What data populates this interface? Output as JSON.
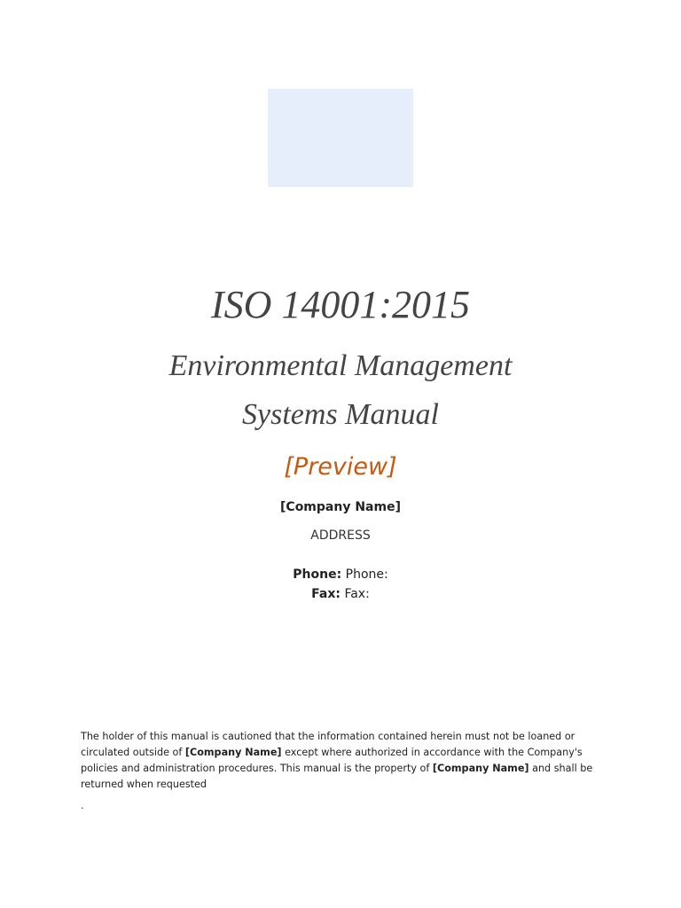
{
  "cover": {
    "standard": "ISO 14001:2015",
    "title_line1": "Environmental Management",
    "title_line2": "Systems Manual",
    "preview": "[Preview]",
    "company": "[Company Name]",
    "address": "ADDRESS",
    "phone_label": "Phone:",
    "phone_value": "Phone:",
    "fax_label": "Fax:",
    "fax_value": "Fax:"
  },
  "disclaimer": {
    "part1": "The holder of this manual is cautioned that the information contained herein must not be loaned or circulated outside of ",
    "company1": "[Company Name]",
    "part2": " except where authorized in accordance with the Company's policies and administration procedures. This manual is the property of ",
    "company2": "[Company Name]",
    "part3": " and shall be returned when requested",
    "trailing": "."
  },
  "colors": {
    "accent": "#c55a11",
    "logo_placeholder": "#e6eefc"
  }
}
